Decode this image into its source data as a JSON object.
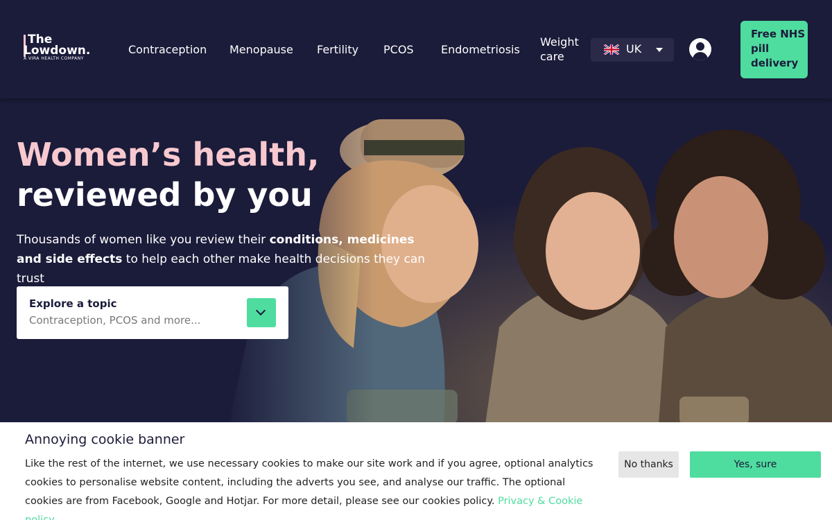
{
  "logo": {
    "line1": "The",
    "line2": "Lowdown.",
    "tagline": "A VIRA HEALTH COMPANY"
  },
  "nav": {
    "items": [
      {
        "label": "Contraception"
      },
      {
        "label": "Menopause"
      },
      {
        "label": "Fertility"
      },
      {
        "label": "PCOS"
      },
      {
        "label": "Endometriosis"
      },
      {
        "label": "Weight care"
      }
    ]
  },
  "country_selector": {
    "flag_icon": "uk-flag-icon",
    "label": "UK"
  },
  "account": {
    "icon": "user-circle-icon"
  },
  "cta": {
    "label": "Free NHS pill delivery"
  },
  "hero": {
    "title_accent": "Women’s health,",
    "title_rest": "reviewed by you",
    "subtitle": {
      "part1": "Thousands of women like you review their ",
      "bold": "conditions, medicines and side effects",
      "part2": " to help each other make health decisions they can trust"
    },
    "explore": {
      "label": "Explore a topic",
      "placeholder": "Contraception, PCOS and more...",
      "button_icon": "chevron-down-icon"
    }
  },
  "cookie_banner": {
    "title": "Annoying cookie banner",
    "text": "Like the rest of the internet, we use necessary cookies to make our site work and if you agree, optional analytics cookies to personalise website content, including the adverts you see, and analyse our traffic. The optional cookies are from Facebook, Google and Hotjar. For more detail, please see our cookies policy. ",
    "link": "Privacy & Cookie policy",
    "decline": "No thanks",
    "accept": "Yes, sure"
  },
  "colors": {
    "background": "#1b1b3a",
    "accent_pink": "#f7c9cf",
    "accent_green": "#4fdc9f",
    "text_dark": "#1b1b3a"
  }
}
